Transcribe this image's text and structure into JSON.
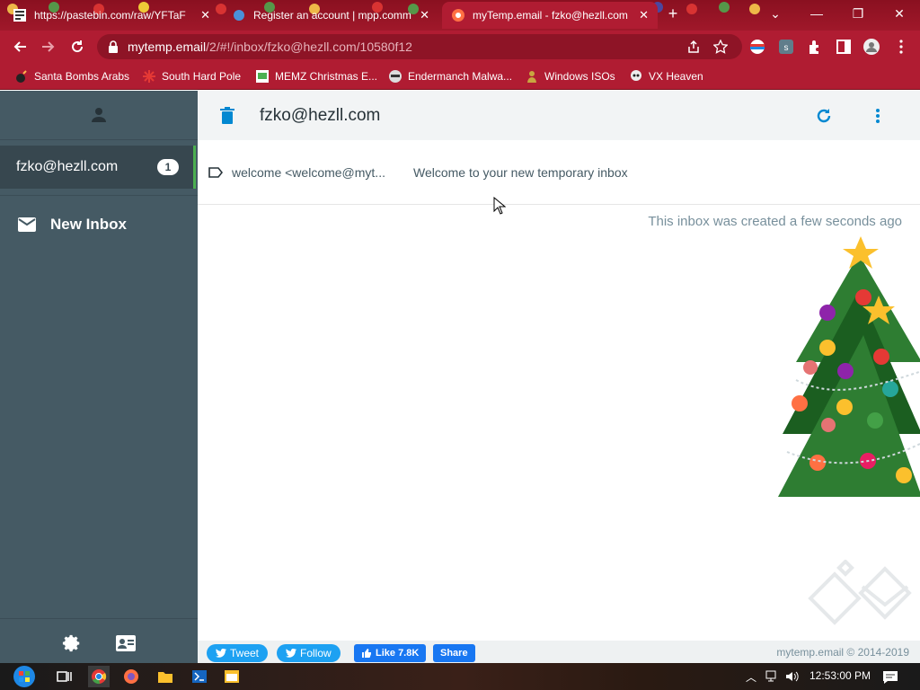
{
  "browser": {
    "tabs": [
      {
        "title": "https://pastebin.com/raw/YFTaF",
        "active": false
      },
      {
        "title": "Register an account | mpp.comm",
        "active": false
      },
      {
        "title": "myTemp.email - fzko@hezll.com",
        "active": true
      }
    ],
    "url_host": "mytemp.email",
    "url_path": "/2/#!/inbox/fzko@hezll.com/10580f12",
    "bookmarks": [
      {
        "label": "Santa Bombs Arabs",
        "icon": "bomb-icon"
      },
      {
        "label": "South Hard Pole",
        "icon": "snowflake-icon"
      },
      {
        "label": "MEMZ Christmas E...",
        "icon": "page-icon"
      },
      {
        "label": "Endermanch Malwa...",
        "icon": "raccoon-icon"
      },
      {
        "label": "Windows ISOs",
        "icon": "person-icon"
      },
      {
        "label": "VX Heaven",
        "icon": "skull-icon"
      }
    ]
  },
  "sidebar": {
    "inbox": {
      "address": "fzko@hezll.com",
      "count": "1"
    },
    "new_inbox_label": "New Inbox"
  },
  "main": {
    "title": "fzko@hezll.com",
    "message": {
      "from": "welcome <welcome@myt...",
      "subject": "Welcome to your new temporary inbox"
    },
    "created_text": "This inbox was created a few seconds ago"
  },
  "footer": {
    "tweet": "Tweet",
    "follow": "Follow",
    "like": "Like 7.8K",
    "share": "Share",
    "copyright": "mytemp.email © 2014-2019"
  },
  "taskbar": {
    "clock": "12:53:00 PM"
  },
  "colors": {
    "sidebar": "#455a64",
    "accent": "#0288d1",
    "browser": "#b01c32"
  }
}
